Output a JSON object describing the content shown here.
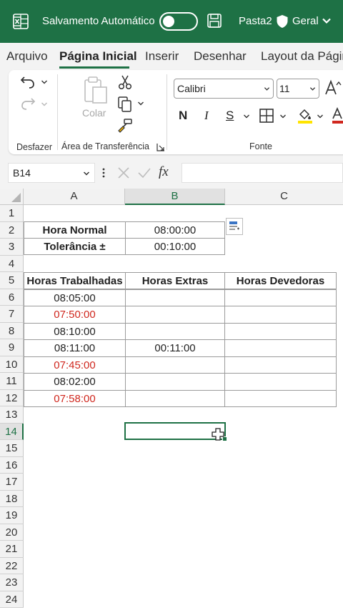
{
  "titlebar": {
    "autosave_label": "Salvamento Automático",
    "filename": "Pasta2",
    "sensitivity": "Geral",
    "color": "#1e7145"
  },
  "tabs": [
    {
      "label": "Arquivo",
      "active": false
    },
    {
      "label": "Página Inicial",
      "active": true
    },
    {
      "label": "Inserir",
      "active": false
    },
    {
      "label": "Desenhar",
      "active": false
    },
    {
      "label": "Layout da Págin",
      "active": false
    }
  ],
  "ribbon": {
    "groups": {
      "undo": "Desfazer",
      "clipboard": "Área de Transferência",
      "font": "Fonte"
    },
    "paste_label": "Colar",
    "font_name": "Calibri",
    "font_size": "11",
    "bold": "N",
    "italic": "I",
    "underline": "S",
    "icons": [
      "undo-icon",
      "redo-icon",
      "paste-icon",
      "cut-icon",
      "copy-icon",
      "format-painter-icon",
      "grow-font-icon",
      "borders-icon",
      "fill-color-icon",
      "font-color-icon"
    ],
    "fill_color": "#ffe400",
    "font_color": "#d0281f"
  },
  "formula_bar": {
    "name_box": "B14",
    "fx": "fx",
    "value": ""
  },
  "sheet": {
    "columns": [
      "A",
      "B",
      "C"
    ],
    "selected_column": "B",
    "rows": [
      "1",
      "2",
      "3",
      "4",
      "5",
      "6",
      "7",
      "8",
      "9",
      "10",
      "11",
      "12",
      "13",
      "14",
      "15",
      "16",
      "17",
      "18",
      "19",
      "20",
      "21",
      "22",
      "23",
      "24"
    ],
    "selected_row": "14",
    "cells": {
      "A2": "Hora Normal",
      "B2": "08:00:00",
      "A3": "Tolerância ±",
      "B3": "00:10:00",
      "A5": "Horas Trabalhadas",
      "B5": "Horas Extras",
      "C5": "Horas Devedoras",
      "A6": "08:05:00",
      "A7": "07:50:00",
      "A8": "08:10:00",
      "A9": "08:11:00",
      "B9": "00:11:00",
      "A10": "07:45:00",
      "A11": "08:02:00",
      "A12": "07:58:00"
    },
    "red_text_color": "#d0281f"
  }
}
